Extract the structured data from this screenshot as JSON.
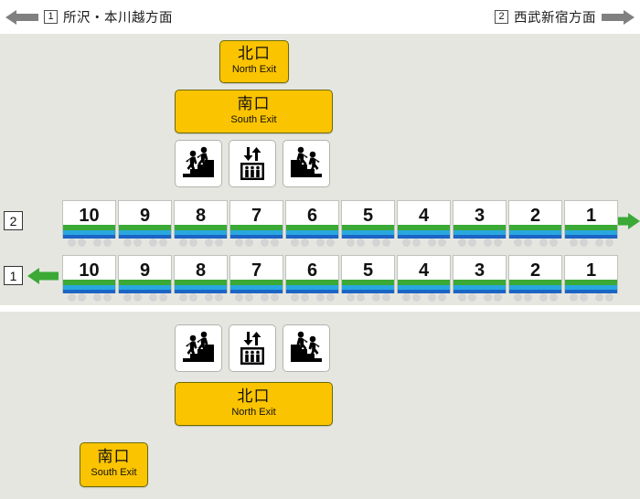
{
  "header": {
    "left": {
      "number": "1",
      "text": "所沢・本川越方面",
      "arrow": "arrow-left-grey"
    },
    "right": {
      "number": "2",
      "text": "西武新宿方面",
      "arrow": "arrow-right-grey"
    }
  },
  "colors": {
    "panel_background": "#e6e6e1",
    "exit_sign": "#fbc400",
    "arrow_green": "#3ba935",
    "arrow_grey": "#808080",
    "stripe_green": "#3ba935",
    "stripe_cyan": "#29a7e0",
    "stripe_blue": "#1b65c6",
    "wheel": "#d4d4d4"
  },
  "top_area": {
    "exits": [
      {
        "id": "north",
        "jp": "北口",
        "en": "North Exit",
        "size": "small"
      },
      {
        "id": "south",
        "jp": "南口",
        "en": "South Exit",
        "size": "wide"
      }
    ],
    "facility_icons": [
      {
        "name": "stairs-up-icon",
        "label": "stairs up"
      },
      {
        "name": "elevator-icon",
        "label": "elevator"
      },
      {
        "name": "stairs-down-icon",
        "label": "stairs down"
      }
    ]
  },
  "bottom_area": {
    "facility_icons": [
      {
        "name": "stairs-up-icon",
        "label": "stairs up"
      },
      {
        "name": "elevator-icon",
        "label": "elevator"
      },
      {
        "name": "stairs-down-icon",
        "label": "stairs down"
      }
    ],
    "exits": [
      {
        "id": "north",
        "jp": "北口",
        "en": "North Exit",
        "size": "wide"
      },
      {
        "id": "south",
        "jp": "南口",
        "en": "South Exit",
        "size": "small"
      }
    ]
  },
  "platforms": [
    {
      "number": "2",
      "direction": "right",
      "arrow": "arrow-right-green",
      "cars": [
        "10",
        "9",
        "8",
        "7",
        "6",
        "5",
        "4",
        "3",
        "2",
        "1"
      ]
    },
    {
      "number": "1",
      "direction": "left",
      "arrow": "arrow-left-green",
      "cars": [
        "10",
        "9",
        "8",
        "7",
        "6",
        "5",
        "4",
        "3",
        "2",
        "1"
      ]
    }
  ]
}
